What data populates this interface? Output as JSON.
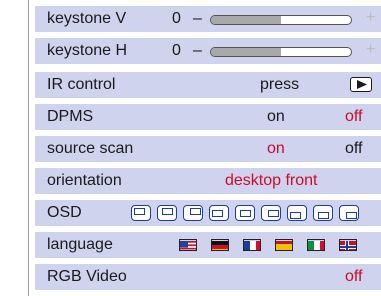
{
  "menu": {
    "keystone_v": {
      "label": "keystone V",
      "value": "0",
      "minus": "–",
      "plus": "+",
      "level": 0.5
    },
    "keystone_h": {
      "label": "keystone H",
      "value": "0",
      "minus": "–",
      "plus": "+",
      "level": 0.5
    },
    "ir_control": {
      "label": "IR control",
      "action": "press",
      "button_icon": "play-icon"
    },
    "dpms": {
      "label": "DPMS",
      "on": "on",
      "off": "off",
      "selected": "off"
    },
    "source_scan": {
      "label": "source scan",
      "on": "on",
      "off": "off",
      "selected": "on"
    },
    "orientation": {
      "label": "orientation",
      "value": "desktop front"
    },
    "osd": {
      "label": "OSD",
      "icon_count": 9,
      "icon_name": "osd-position-icon"
    },
    "language": {
      "label": "language",
      "flags": [
        "us-flag-icon",
        "de-flag-icon",
        "fr-flag-icon",
        "es-flag-icon",
        "it-flag-icon",
        "no-flag-icon"
      ]
    },
    "rgb_video": {
      "label": "RGB Video",
      "value": "off"
    }
  },
  "colors": {
    "row_bg": "#cfd3ee",
    "selected": "#cc0a2a",
    "text": "#1a1a1a",
    "icon_blue": "#1f3c9c"
  }
}
